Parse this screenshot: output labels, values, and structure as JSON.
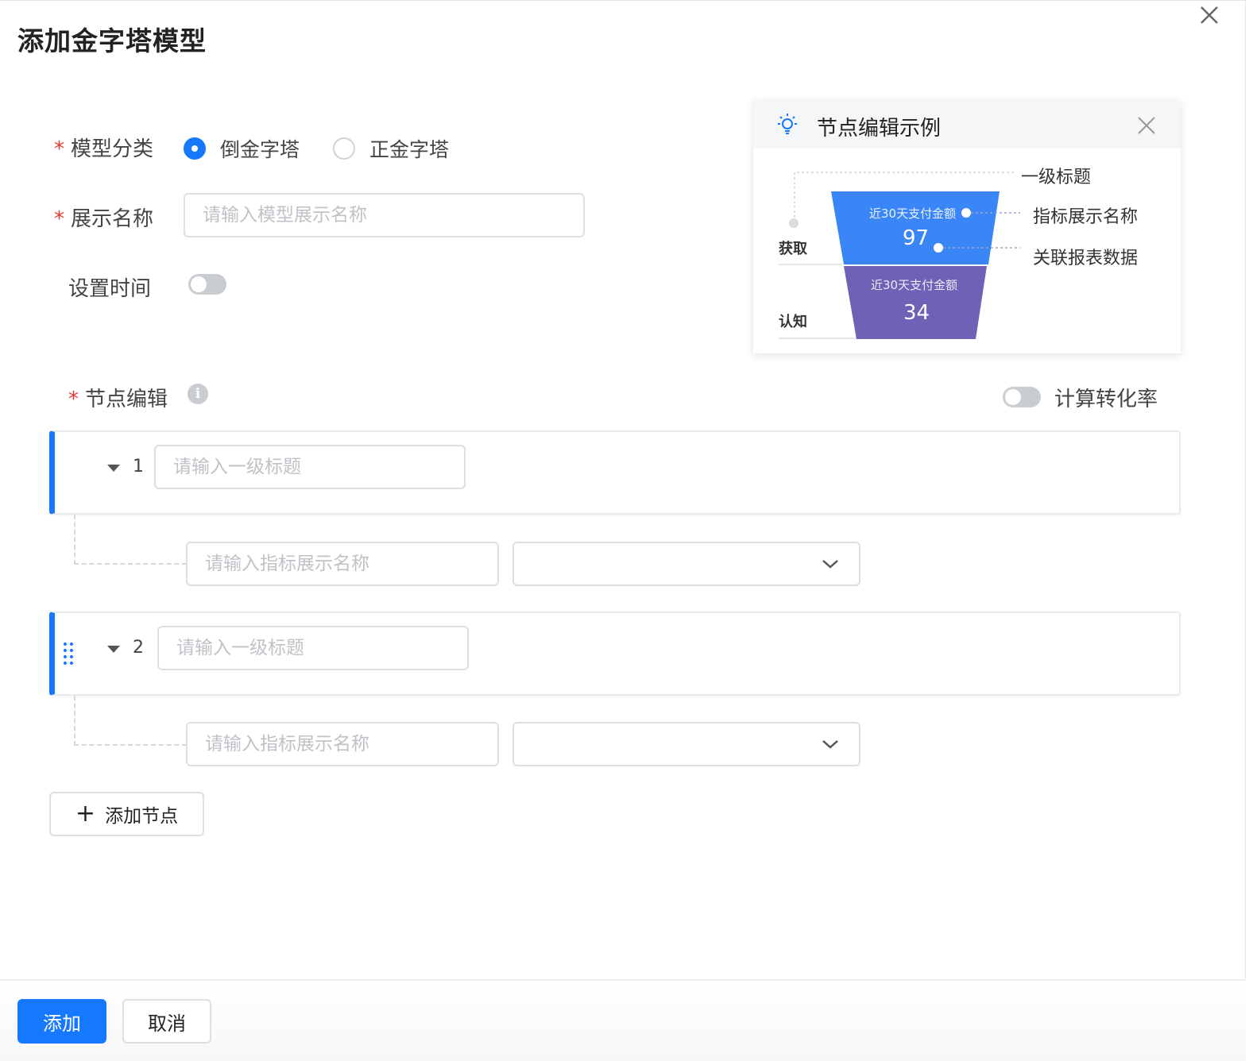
{
  "dialog": {
    "title": "添加金字塔模型"
  },
  "form": {
    "model_type": {
      "label": "模型分类",
      "options": [
        {
          "label": "倒金字塔",
          "checked": true
        },
        {
          "label": "正金字塔",
          "checked": false
        }
      ]
    },
    "display_name": {
      "label": "展示名称",
      "placeholder": "请输入模型展示名称"
    },
    "set_time": {
      "label": "设置时间",
      "on": false
    },
    "node_edit": {
      "label": "节点编辑",
      "conversion_label": "计算转化率",
      "conversion_on": false
    }
  },
  "example": {
    "title": "节点编辑示例",
    "legend": {
      "level1_title": "一级标题",
      "metric_name": "指标展示名称",
      "linked_data": "关联报表数据"
    },
    "rows": [
      {
        "stage": "获取",
        "metric": "近30天支付金额",
        "value": "97",
        "color": "#3a86f7"
      },
      {
        "stage": "认知",
        "metric": "近30天支付金额",
        "value": "34",
        "color": "#6f61b6"
      }
    ]
  },
  "nodes": [
    {
      "index": "1",
      "title_placeholder": "请输入一级标题",
      "metric_placeholder": "请输入指标展示名称"
    },
    {
      "index": "2",
      "title_placeholder": "请输入一级标题",
      "metric_placeholder": "请输入指标展示名称"
    }
  ],
  "add_node_label": "添加节点",
  "footer": {
    "submit_label": "添加",
    "cancel_label": "取消"
  },
  "colors": {
    "primary": "#1677ff",
    "required": "#e53935"
  }
}
